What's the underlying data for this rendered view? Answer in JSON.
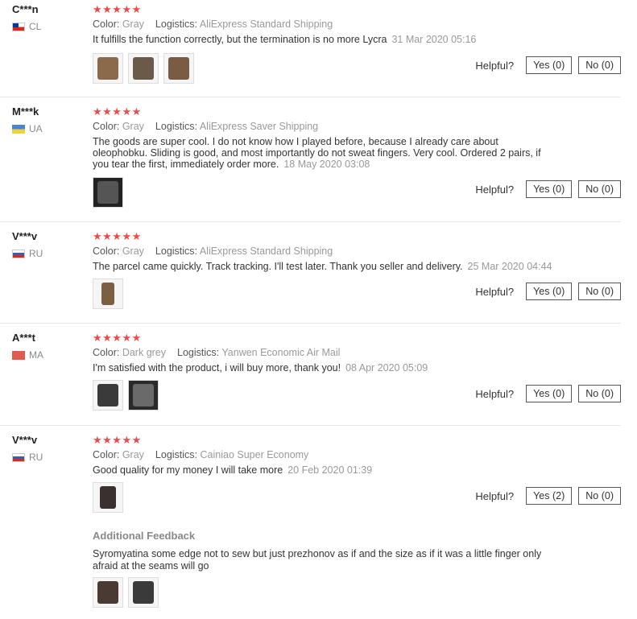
{
  "labels": {
    "color": "Color:",
    "logistics": "Logistics:",
    "helpful": "Helpful?"
  },
  "reviews": [
    {
      "user": "C***n",
      "country": "CL",
      "stars": "★★★★★",
      "color": "Gray",
      "logistics": "AliExpress Standard Shipping",
      "text": "It fulfills the function correctly, but the termination is no more Lycra",
      "date": "31 Mar 2020 05:16",
      "yes": "Yes (0)",
      "no": "No (0)"
    },
    {
      "user": "M***k",
      "country": "UA",
      "stars": "★★★★★",
      "color": "Gray",
      "logistics": "AliExpress Saver Shipping",
      "text": "The goods are super cool. I do not know how I played before, because I already care about oleophobku. Sliding is good, and most importantly do not sweat fingers. Very cool. Ordered 2 pairs, if you tear the first, immediately order more.",
      "date": "18 May 2020 03:08",
      "yes": "Yes (0)",
      "no": "No (0)"
    },
    {
      "user": "V***v",
      "country": "RU",
      "stars": "★★★★★",
      "color": "Gray",
      "logistics": "AliExpress Standard Shipping",
      "text": "The parcel came quickly. Track tracking. I'll test later. Thank you seller and delivery.",
      "date": "25 Mar 2020 04:44",
      "yes": "Yes (0)",
      "no": "No (0)"
    },
    {
      "user": "A***t",
      "country": "MA",
      "stars": "★★★★★",
      "color": "Dark grey",
      "logistics": "Yanwen Economic Air Mail",
      "text": "I'm satisfied with the product, i will buy more, thank you!",
      "date": "08 Apr 2020 05:09",
      "yes": "Yes (0)",
      "no": "No (0)"
    },
    {
      "user": "V***v",
      "country": "RU",
      "stars": "★★★★★",
      "color": "Gray",
      "logistics": "Cainiao Super Economy",
      "text": "Good quality for my money I will take more",
      "date": "20 Feb 2020 01:39",
      "yes": "Yes (2)",
      "no": "No (0)",
      "additional_title": "Additional Feedback",
      "additional_text": "Syromyatina some edge not to sew but just prezhonov as if and the size as if it was a little finger only afraid at the seams will go"
    }
  ]
}
